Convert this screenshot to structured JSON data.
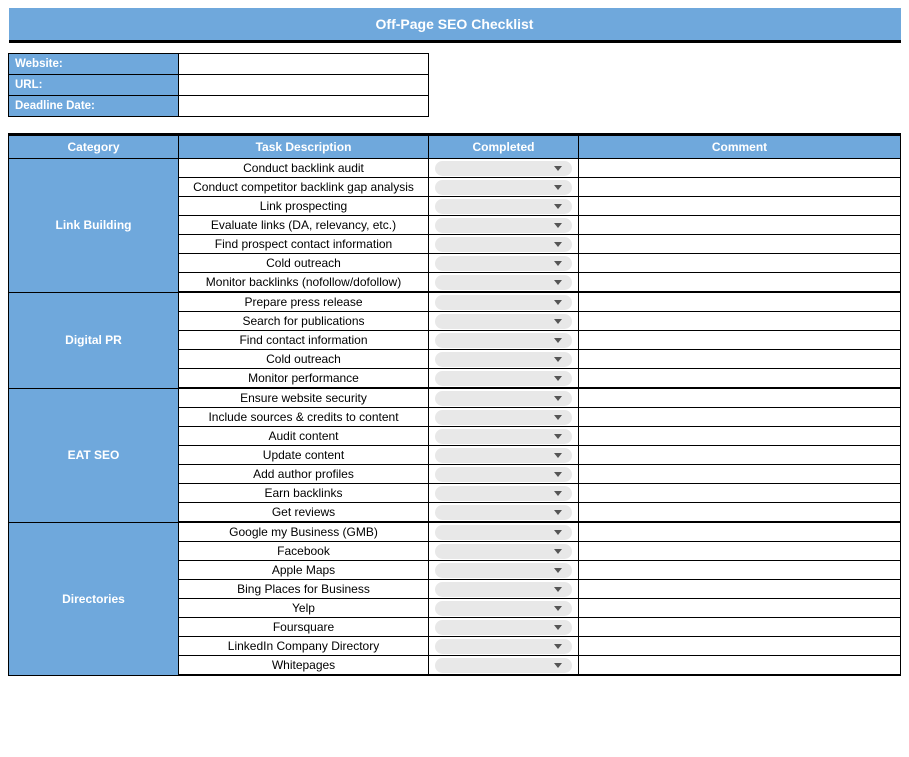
{
  "title": "Off-Page SEO Checklist",
  "info": [
    {
      "label": "Website:",
      "value": ""
    },
    {
      "label": "URL:",
      "value": ""
    },
    {
      "label": "Deadline Date:",
      "value": ""
    }
  ],
  "headers": {
    "category": "Category",
    "task": "Task Description",
    "completed": "Completed",
    "comment": "Comment"
  },
  "sections": [
    {
      "category": "Link Building",
      "tasks": [
        "Conduct backlink audit",
        "Conduct competitor backlink gap analysis",
        "Link prospecting",
        "Evaluate links (DA, relevancy, etc.)",
        "Find prospect contact information",
        "Cold outreach",
        "Monitor backlinks (nofollow/dofollow)"
      ]
    },
    {
      "category": "Digital PR",
      "tasks": [
        "Prepare press release",
        "Search for publications",
        "Find contact information",
        "Cold outreach",
        "Monitor performance"
      ]
    },
    {
      "category": "EAT SEO",
      "tasks": [
        "Ensure website security",
        "Include sources & credits to content",
        "Audit content",
        "Update content",
        "Add author profiles",
        "Earn backlinks",
        "Get reviews"
      ]
    },
    {
      "category": "Directories",
      "tasks": [
        "Google my Business (GMB)",
        "Facebook",
        "Apple Maps",
        "Bing Places for Business",
        "Yelp",
        "Foursquare",
        "LinkedIn Company Directory",
        "Whitepages"
      ]
    }
  ]
}
